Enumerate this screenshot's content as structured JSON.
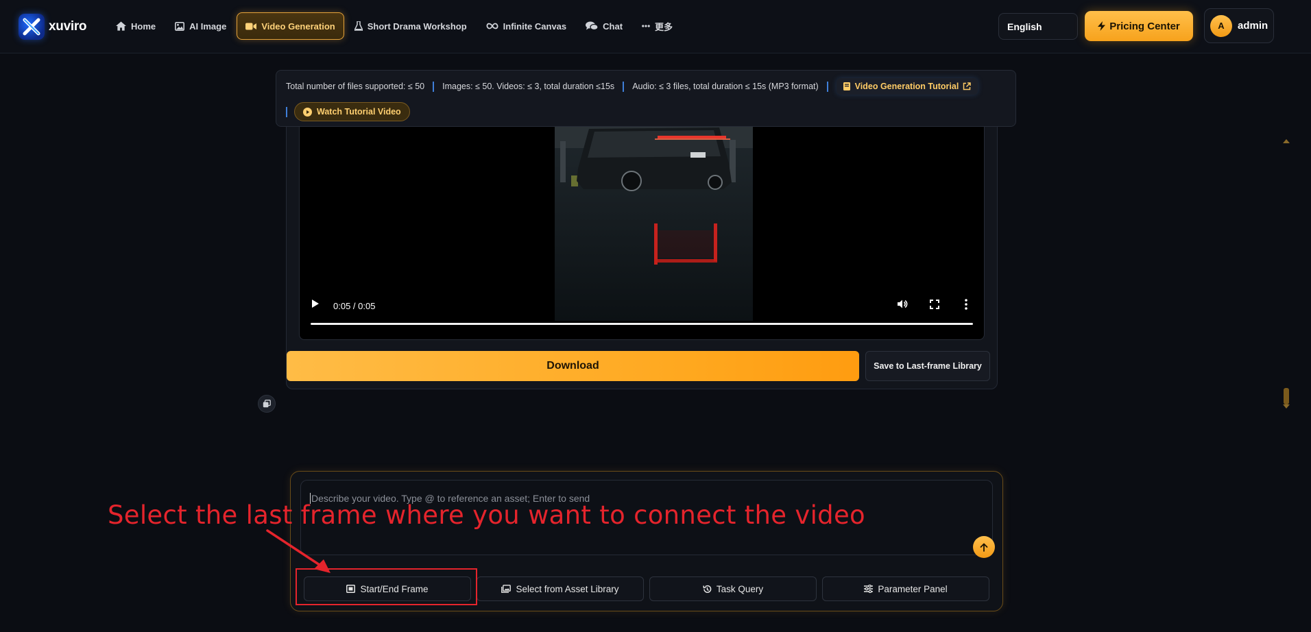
{
  "app": {
    "name": "xuviro"
  },
  "nav": {
    "items": [
      {
        "label": "Home",
        "icon": "home-icon"
      },
      {
        "label": "AI Image",
        "icon": "image-icon"
      },
      {
        "label": "Video Generation",
        "icon": "video-camera-icon",
        "active": true
      },
      {
        "label": "Short Drama Workshop",
        "icon": "flask-icon"
      },
      {
        "label": "Infinite Canvas",
        "icon": "infinity-icon"
      },
      {
        "label": "Chat",
        "icon": "chat-icon"
      },
      {
        "label": "更多",
        "icon": "more-dots-icon"
      }
    ],
    "language": "English",
    "pricing": "Pricing Center",
    "user": {
      "initial": "A",
      "name": "admin"
    }
  },
  "info": {
    "files_total": "Total number of files supported: ≤ 50",
    "images_videos": "Images: ≤ 50. Videos: ≤ 3, total duration ≤15s",
    "audio": "Audio: ≤ 3 files, total duration ≤ 15s (MP3 format)",
    "tutorial_link": "Video Generation Tutorial",
    "watch_tutorial": "Watch Tutorial Video"
  },
  "result": {
    "video_time": "0:05 / 0:05",
    "progress": 1.0,
    "download_label": "Download",
    "save_last_frame_label": "Save to Last-frame Library"
  },
  "composer": {
    "placeholder": "Describe your video. Type @ to reference an asset; Enter to send",
    "actions": [
      {
        "label": "Start/End Frame",
        "icon": "film-frame-icon"
      },
      {
        "label": "Select from Asset Library",
        "icon": "image-library-icon"
      },
      {
        "label": "Task Query",
        "icon": "history-icon"
      },
      {
        "label": "Parameter Panel",
        "icon": "sliders-icon"
      }
    ]
  },
  "annotation": {
    "text": "Select the last frame where you want to connect the video",
    "color": "#e5242c"
  },
  "colors": {
    "accent": "#f7a21c",
    "background": "#0b0d13",
    "separator": "#3f7fd9"
  }
}
